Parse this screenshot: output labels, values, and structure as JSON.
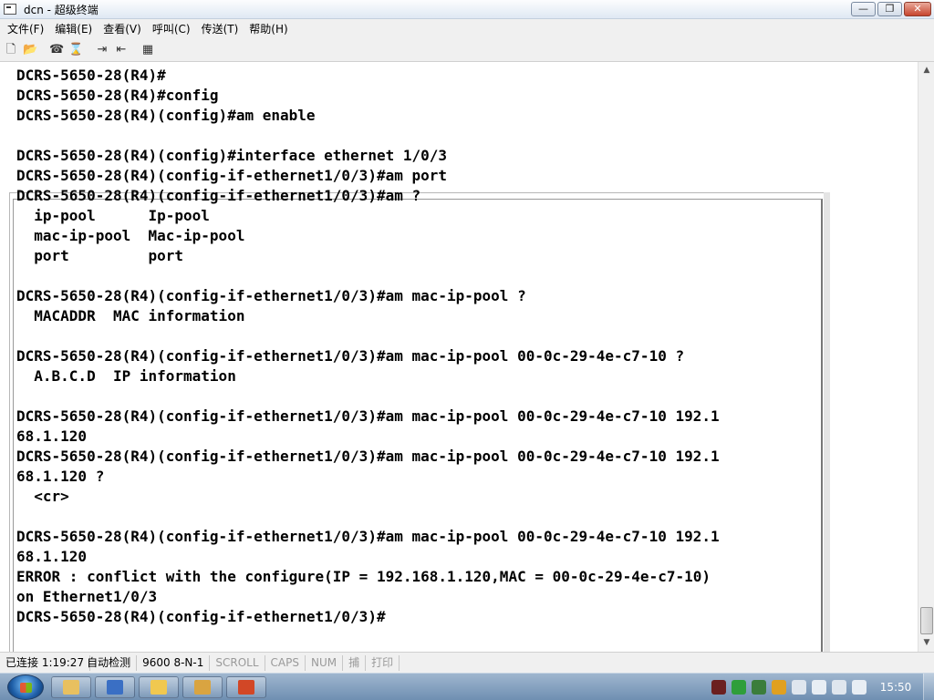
{
  "window": {
    "title": "dcn - 超级终端",
    "minimize": "—",
    "maximize": "❐",
    "close": "✕"
  },
  "menu": [
    "文件(F)",
    "编辑(E)",
    "查看(V)",
    "呼叫(C)",
    "传送(T)",
    "帮助(H)"
  ],
  "toolbar": {
    "icons": [
      "new-icon",
      "open-icon",
      "disconnect-icon",
      "dial-icon",
      "send-icon",
      "receive-icon",
      "properties-icon"
    ]
  },
  "terminal": {
    "lines": [
      "DCRS-5650-28(R4)#",
      "DCRS-5650-28(R4)#config",
      "DCRS-5650-28(R4)(config)#am enable",
      "DCRS-5650-28(R4)(config)#interface ethernet 1/0/3",
      "DCRS-5650-28(R4)(config-if-ethernet1/0/3)#am port",
      "DCRS-5650-28(R4)(config-if-ethernet1/0/3)#am ?",
      "  ip-pool      Ip-pool",
      "  mac-ip-pool  Mac-ip-pool",
      "  port         port",
      "",
      "DCRS-5650-28(R4)(config-if-ethernet1/0/3)#am mac-ip-pool ?",
      "  MACADDR  MAC information",
      "",
      "DCRS-5650-28(R4)(config-if-ethernet1/0/3)#am mac-ip-pool 00-0c-29-4e-c7-10 ?",
      "  A.B.C.D  IP information",
      "",
      "DCRS-5650-28(R4)(config-if-ethernet1/0/3)#am mac-ip-pool 00-0c-29-4e-c7-10 192.1",
      "68.1.120",
      "DCRS-5650-28(R4)(config-if-ethernet1/0/3)#am mac-ip-pool 00-0c-29-4e-c7-10 192.1",
      "68.1.120 ?",
      "  <cr>",
      "",
      "DCRS-5650-28(R4)(config-if-ethernet1/0/3)#am mac-ip-pool 00-0c-29-4e-c7-10 192.1",
      "68.1.120",
      "ERROR : conflict with the configure(IP = 192.168.1.120,MAC = 00-0c-29-4e-c7-10)",
      "on Ethernet1/0/3",
      "DCRS-5650-28(R4)(config-if-ethernet1/0/3)#"
    ]
  },
  "statusbar": {
    "connection": "已连接 1:19:27",
    "detect": "自动检测",
    "port_settings": "9600 8-N-1",
    "scroll": "SCROLL",
    "caps": "CAPS",
    "num": "NUM",
    "capture": "捕",
    "print": "打印"
  },
  "taskbar": {
    "clock": "15:50",
    "apps": [
      "explorer-icon",
      "word-icon",
      "folder-icon",
      "package-icon",
      "powerpoint-icon"
    ]
  }
}
